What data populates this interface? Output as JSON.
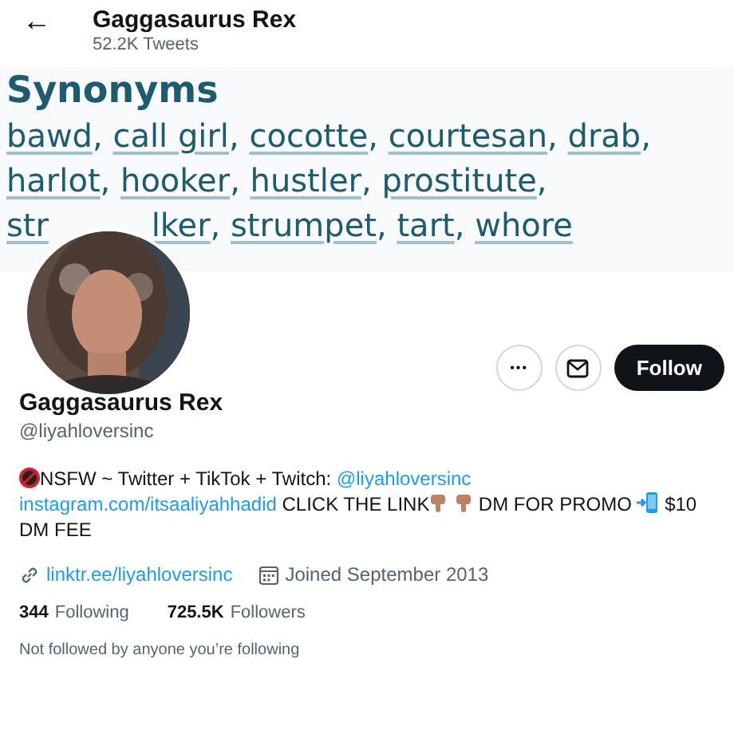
{
  "header": {
    "back": "←",
    "name": "Gaggasaurus Rex",
    "tweets": "52.2K Tweets"
  },
  "banner": {
    "title": "Synonyms",
    "lines": [
      [
        {
          "text": "bawd",
          "sep": ","
        },
        {
          "text": "call girl",
          "sep": ","
        },
        {
          "text": "cocotte",
          "sep": ","
        },
        {
          "text": "courtesan",
          "sep": ","
        },
        {
          "text": "drab",
          "sep": ","
        }
      ],
      [
        {
          "text": "harlot",
          "sep": ","
        },
        {
          "text": "hooker",
          "sep": ","
        },
        {
          "text": "hustler",
          "sep": ","
        },
        {
          "text": "prostitute",
          "sep": ","
        }
      ],
      [
        {
          "text": "str"
        },
        {
          "text": "lker",
          "sep": ","
        },
        {
          "text": "strumpet",
          "sep": ","
        },
        {
          "text": "tart",
          "sep": ","
        },
        {
          "text": "whore"
        }
      ]
    ]
  },
  "actions": {
    "more": "•••",
    "follow": "Follow"
  },
  "profile": {
    "name": "Gaggasaurus Rex",
    "handle": "@liyahloversinc",
    "bio": [
      {
        "kind": "adult"
      },
      {
        "kind": "text",
        "text": "NSFW ~ Twitter + TikTok + Twitch: "
      },
      {
        "kind": "link",
        "text": "@liyahloversinc"
      },
      {
        "kind": "link",
        "text": "instagram.com/itsaaliyahhadid"
      },
      {
        "kind": "text",
        "text": " CLICK THE LINK"
      },
      {
        "kind": "pointdown"
      },
      {
        "kind": "pointdown"
      },
      {
        "kind": "text",
        "text": " DM FOR PROMO "
      },
      {
        "kind": "phone"
      },
      {
        "kind": "text",
        "text": " $10 DM FEE"
      }
    ],
    "website": "linktr.ee/liyahloversinc",
    "joined": "Joined September 2013",
    "following_count": "344",
    "following_label": "Following",
    "followers_count": "725.5K",
    "followers_label": "Followers",
    "note": "Not followed by anyone you’re following"
  }
}
